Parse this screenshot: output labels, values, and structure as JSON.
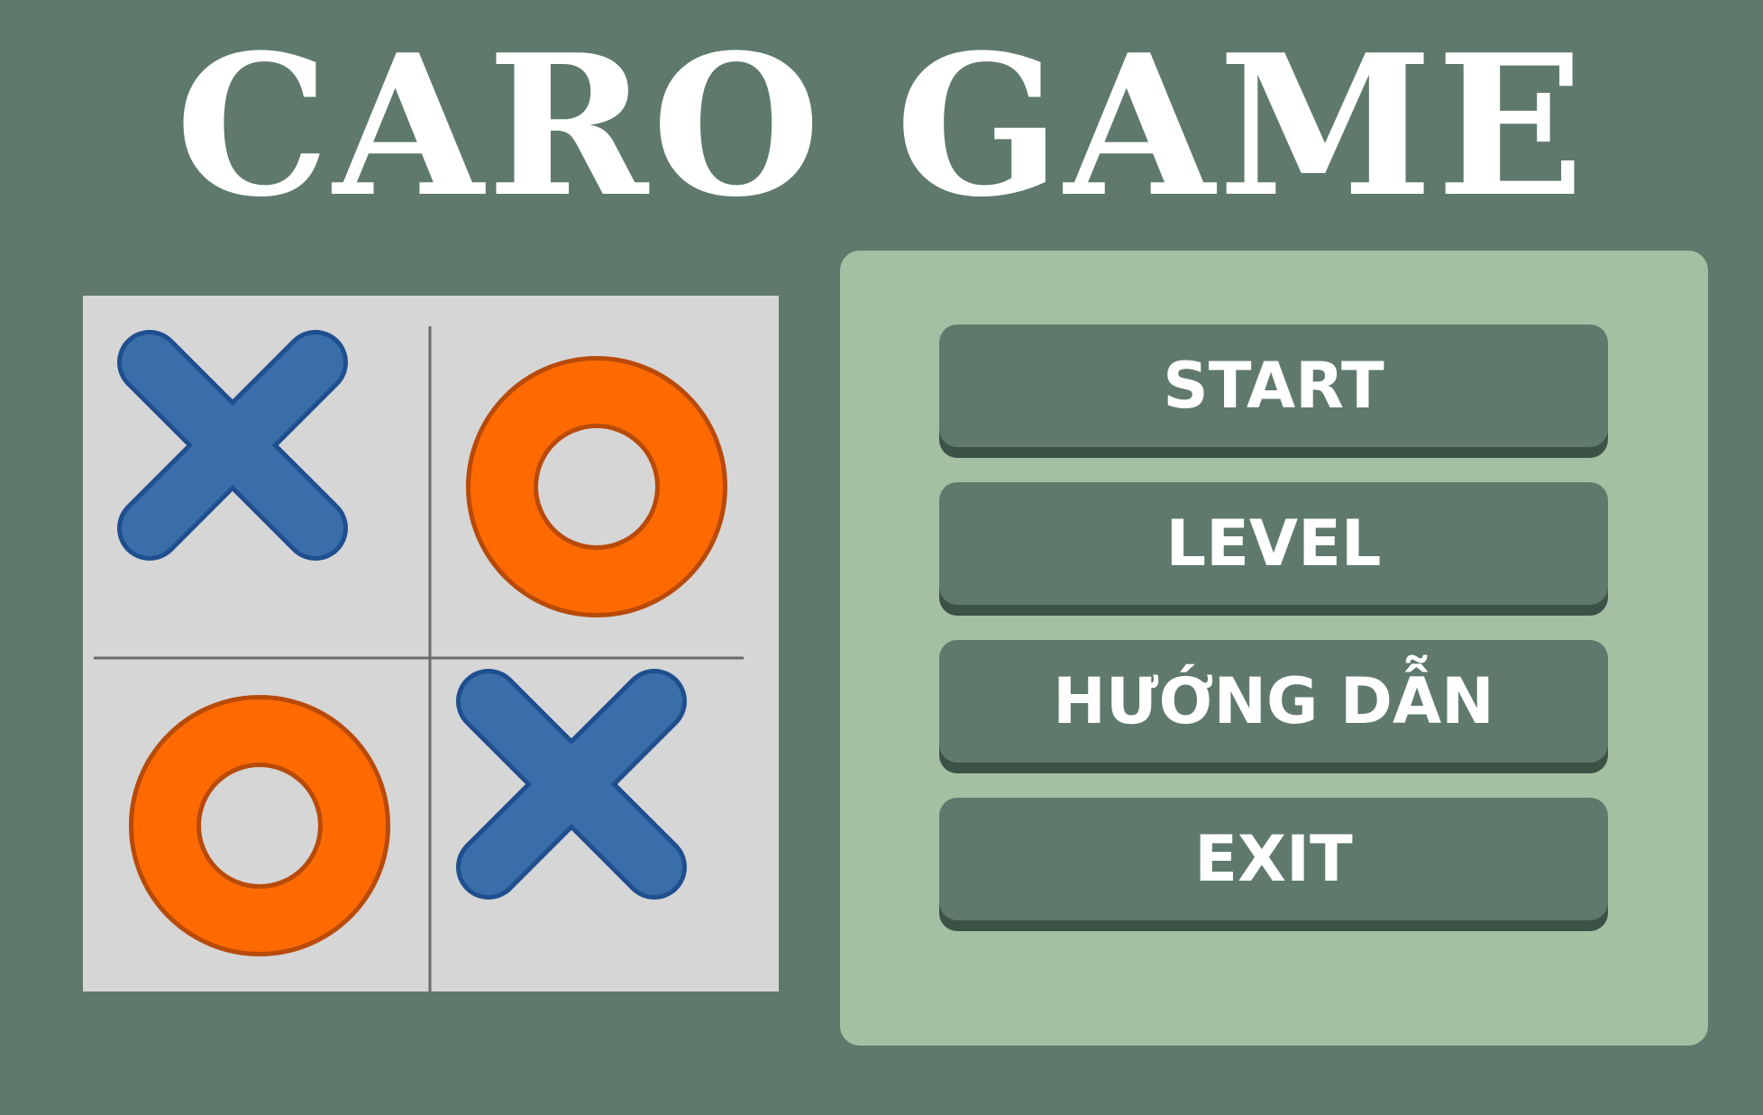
{
  "title": "CARO GAME",
  "board": {
    "size": 2,
    "cells": [
      [
        "X",
        "O"
      ],
      [
        "O",
        "X"
      ]
    ],
    "colors": {
      "board_background": "#d6d6d6",
      "grid_line": "#6b6b6b",
      "x_mark": "#3a6ea8",
      "x_outline": "#1f4f8f",
      "o_mark": "#ff6a00",
      "o_outline": "#b84a0a"
    }
  },
  "menu": {
    "start_label": "START",
    "level_label": "LEVEL",
    "guide_label": "HƯỚNG DẪN",
    "exit_label": "EXIT"
  },
  "colors": {
    "background": "#5f7a6c",
    "panel": "#a3c0a2",
    "button": "#5f7a6c",
    "button_shadow": "#3d5246",
    "text": "#ffffff"
  }
}
